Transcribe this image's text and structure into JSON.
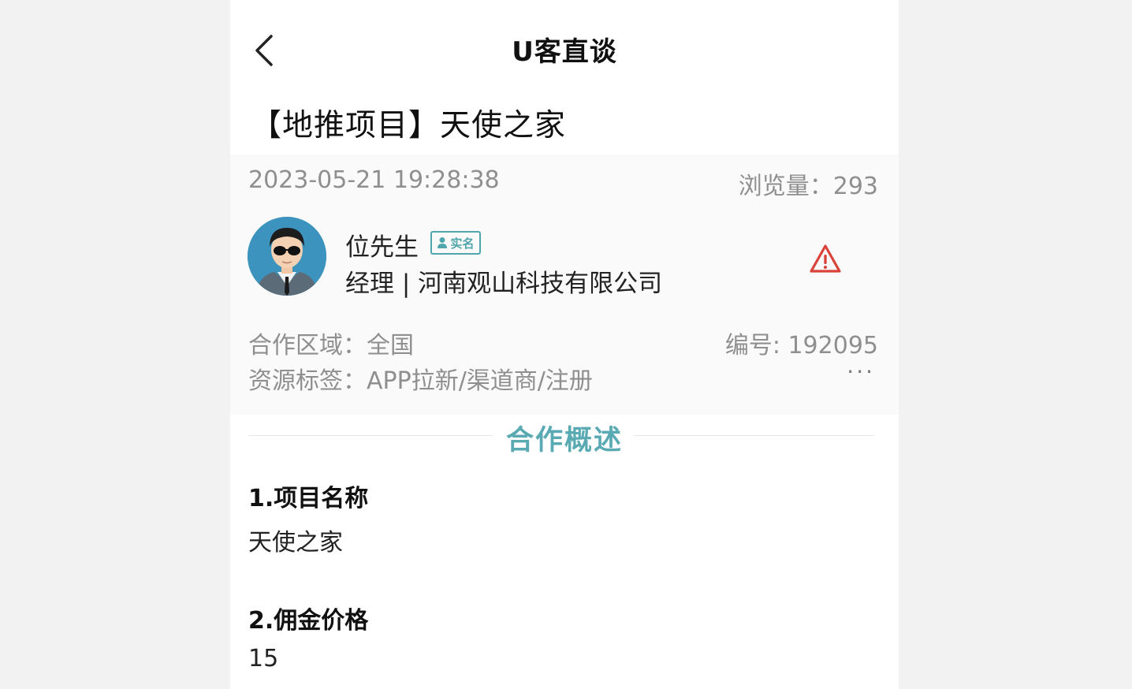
{
  "nav": {
    "title": "U客直谈"
  },
  "post": {
    "title": "【地推项目】天使之家",
    "datetime": "2023-05-21 19:28:38",
    "views": "浏览量：293"
  },
  "author": {
    "name": "位先生",
    "badge": "实名",
    "line": "经理 | 河南观山科技有限公司"
  },
  "details": {
    "region": "合作区域：全国",
    "serial": "编号: 192095",
    "tags": "资源标签：APP拉新/渠道商/注册",
    "more": "···"
  },
  "overview": {
    "title": "合作概述",
    "items": [
      {
        "heading": "1.项目名称",
        "value": "天使之家"
      },
      {
        "heading": "2.佣金价格",
        "value": "15"
      }
    ]
  },
  "colors": {
    "accent": "#5aaab4",
    "warning": "#d9433a",
    "muted": "#8f8f8f"
  },
  "icons": {
    "back": "chevron-left-icon",
    "report": "warning-triangle-icon",
    "badge": "person-icon"
  }
}
